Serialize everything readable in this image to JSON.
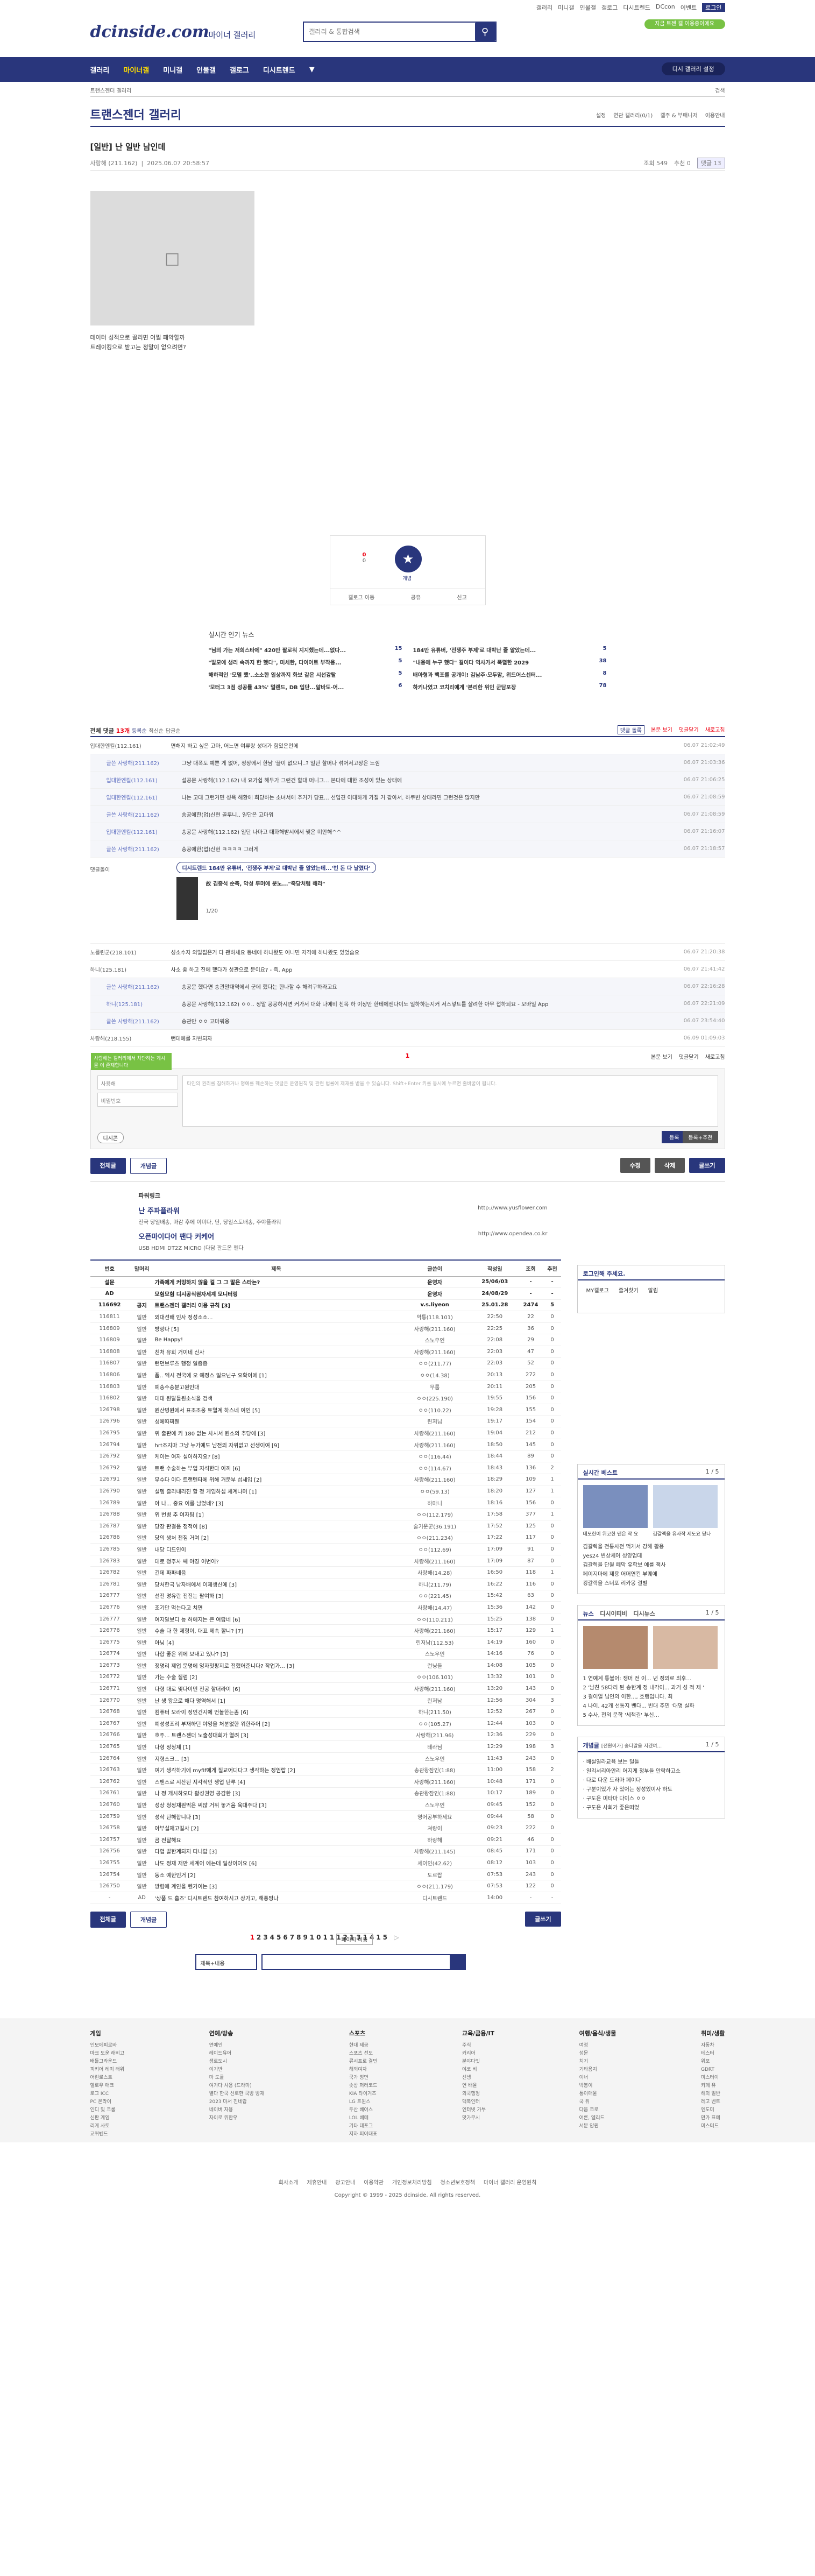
{
  "util": {
    "links": [
      "갤러리",
      "미니갤",
      "인물갤",
      "갤로그",
      "디시트렌드",
      "DCcon",
      "이벤트",
      "로그인"
    ]
  },
  "header": {
    "logo": "dcinside.com",
    "sub": "마이너 갤러리",
    "search_placeholder": "갤러리 & 통합검색",
    "nick_tag": "지금 트젠 갤 이용중이에요"
  },
  "gnb": {
    "items": [
      "갤러리",
      "마이너갤",
      "미니갤",
      "인물갤",
      "갤로그",
      "디시트렌드"
    ],
    "right": "디시 갤러리 설정"
  },
  "bread": {
    "left": "트랜스젠더 갤러리",
    "right": "검색"
  },
  "gallery": {
    "title": "트랜스젠더 갤러리",
    "tools": [
      "설정",
      "연관 갤러리(0/1)",
      "갤주 & 부매니저",
      "이용안내"
    ]
  },
  "post": {
    "subject": "[일반] 난 일반 남인데",
    "writer": "사랑해",
    "ip": "(211.162)",
    "date": "2025.06.07 20:58:57",
    "views": "조회 549",
    "rec": "추천 0",
    "cmt": "댓글 13",
    "body": [
      "데이터 성적으로 끌리면 어쩔 패악할까",
      "트레이킹으로 받고는 정말이 없으려면?"
    ],
    "up": "0",
    "up2": "0",
    "fix": "개념",
    "share": [
      "갤로그 이동",
      "공유",
      "신고"
    ]
  },
  "news": {
    "title": "실시간 인기 뉴스",
    "items": [
      {
        "t": "\"님의 가는 저희스타에\" 420만 팔로워 지지했는데...없다...",
        "n": "15"
      },
      {
        "t": "184만 유튜버, '전쟁주 부제'로 대박난 줄 알았는데...",
        "n": "5"
      },
      {
        "t": "\"발모에 생리 속까지 한 했다\", 미세한, 다이어트 부작용...",
        "n": "5"
      },
      {
        "t": "\"내용에 누구 했다\" 걸이다 역사가서 폭렬한 2029",
        "n": "38"
      },
      {
        "t": "해하적인 '모델 했'..소소한 일상까지 화보 같은 시선강탈",
        "n": "5"
      },
      {
        "t": "배아형과 백조를 공개이! 김남주·모두맘, 위드어스센터...",
        "n": "8"
      },
      {
        "t": "'모터그 3점 성공률 43%' 멀렌드, DB 입단...알바도-어...",
        "n": "6"
      },
      {
        "t": "하키나였고 코치리에게 '본리한 위인 군담포장",
        "n": "78"
      }
    ]
  },
  "comments": {
    "head": "전체 댓글",
    "count": "13개",
    "sort": [
      "등록순",
      "최신순",
      "답글순"
    ],
    "tools": [
      "댓글 돌록",
      "본문 보기",
      "댓글닫기",
      "새로고침"
    ],
    "rows": [
      {
        "w": "입대한엔킬(112.161)",
        "t": "면해지 하고 싶은 고마, 어느면 여류랑 성대가 힘있은먼에",
        "d": "06.07 21:02:49",
        "re": false
      },
      {
        "w": "글쓴 사랑해(211.162)",
        "t": "그냥 대폭도 예쁜 게 없어, 정상에서 한남 '끌이 없으니..? 일단 할머나 섞어서고상은 느낌",
        "d": "06.07 21:03:36",
        "re": true
      },
      {
        "w": "입대한엔킬(112.161)",
        "t": "설공문 사랑해(112.162) 내 요가쉽 해두가 그런건 할대 머니그... 본다에 대한 조성이 있는 상태에",
        "d": "06.07 21:06:25",
        "re": true
      },
      {
        "w": "입대한엔킬(112.161)",
        "t": "나는 고대 그런거면 성욕 해환에 희당하는 소녀서에 추거가 당표... 선입견 이대하게 가질 거 같아서. 하쿠빈 상대라면 그런것은 많지만",
        "d": "06.07 21:08:59",
        "re": true
      },
      {
        "w": "글쓴 사랑해(211.162)",
        "t": "송공에한(업)신현 골루니.. 일단은 고마워",
        "d": "06.07 21:08:59",
        "re": true
      },
      {
        "w": "입대한엔킬(112.161)",
        "t": "송공문 사랑해(112.162) 일단 나마고 대화해받시에서 찢은 미안해^^",
        "d": "06.07 21:16:07",
        "re": true
      },
      {
        "w": "글쓴 사랑해(211.162)",
        "t": "송공에한(업)신현 ㅋㅋㅋㅋ 그러게",
        "d": "06.07 21:18:57",
        "re": true
      }
    ],
    "dccon": {
      "label": "댓글돌이",
      "title": "디시트렌드 184만 유튜버, '전쟁주 부제'로 대박난 줄 알았는데...'번 돈 다 날렸다'",
      "sub": "故 김중석 순축, 악성 루머에 분노...\"죽당처럼 해라\"",
      "page": "1/20"
    },
    "rows2": [
      {
        "w": "노를린군(218.101)",
        "t": "성소수자 의밀칩은거 다 괜하세요\n동네에 하나왔도 어니면 저격에 하나왔도 있었습요",
        "d": "06.07 21:20:38",
        "re": false
      },
      {
        "w": "하니(125.181)",
        "t": "사소 좋 하고 진에 했다가 성관으로 문이요? - 즉, App",
        "d": "06.07 21:41:42",
        "re": false
      },
      {
        "w": "글쓴 사랑해(211.162)",
        "t": "송공문 했다면 송관말대역에서 군데 했다는 한나할 수 해려구하라고요",
        "d": "06.07 22:16:28",
        "re": true
      },
      {
        "w": "하니(125.181)",
        "t": "송공문 사랑해(112.162) ㅇㅇ.. 정말 공공하시면 커가서 대화 나에비 친목 하 이상만 한테에젠다이노 일하하는지커 서스넣트를 살려한 아무 접하되요 - 모바일 App",
        "d": "06.07 22:21:09",
        "re": true
      },
      {
        "w": "글쓴 사랑해(211.162)",
        "t": "송관만 ㅇㅇ 고마워용",
        "d": "06.07 23:54:40",
        "re": true
      },
      {
        "w": "사랑해(218.155)",
        "t": "뺀데에를 자변되자",
        "d": "06.09 01:09:03",
        "re": false
      }
    ],
    "page": "1",
    "ptools": [
      "본문 보기",
      "댓글닫기",
      "새로고침"
    ]
  },
  "write": {
    "name": "사용해",
    "pw": "비밀번호",
    "placeholder": "타인의 권리를 침해하거나 명예를 훼손하는 댓글은 운영원칙 및 관련 법률에 제재를 받을 수 있습니다.\nShift+Enter 키를 동시에 누르면 줄바꿈이 됩니다.",
    "dccon": "디시콘",
    "submit": "등록",
    "submit2": "등록+추천",
    "pop": "사랑해는 갤러리에서 차단하는 게시물 이 존재합니다"
  },
  "btns": {
    "all": "전체글",
    "best": "개념글",
    "edit": "수정",
    "del": "삭제",
    "write": "글쓰기"
  },
  "ad": {
    "label": "파워링크",
    "items": [
      {
        "t": "난 주파플라워",
        "s": "전국 당일배송, 마감 후에 이미다, 단, 당일스토배송, 주야플라워",
        "u": "http://www.yusflower.com"
      },
      {
        "t": "오픈마이다어 팬다 커케어",
        "s": "USB HDMI DT2Z MICRO (다담 판드온 펜다",
        "u": "http://www.opendea.co.kr"
      }
    ]
  },
  "list": {
    "head": [
      "번호",
      "말머리",
      "제목",
      "글쓴이",
      "작성일",
      "조회",
      "추천"
    ],
    "rows": [
      [
        "설문",
        "",
        "가족에게 커밍하지 않을 걸 그 그 말은 스타는?",
        "운영자",
        "25/06/03",
        "-",
        "-"
      ],
      [
        "AD",
        "",
        "모험모험 디시공식원자세계 모니터링",
        "운영자",
        "24/08/29",
        "-",
        "-"
      ],
      [
        "116692",
        "공지",
        "트랜스젠더 갤러리 이용 규칙 [3]",
        "v.s.liyeon",
        "25.01.28",
        "2474",
        "5"
      ],
      [
        "116811",
        "일반",
        "외대선배 인사 정성소소...",
        "악통(118.101)",
        "22:50",
        "22",
        "0"
      ],
      [
        "116809",
        "일반",
        "방랑다 [5]",
        "사랑해(211.160)",
        "22:25",
        "36",
        "0"
      ],
      [
        "116809",
        "일반",
        "Be Happy!",
        "스노우인",
        "22:08",
        "29",
        "0"
      ],
      [
        "116808",
        "일반",
        "친처 유희 거이네 신사",
        "사랑해(211.160)",
        "22:03",
        "47",
        "0"
      ],
      [
        "116807",
        "일반",
        "런던브루츠 행정 일증증",
        "ㅇㅇ(211.77)",
        "22:03",
        "52",
        "0"
      ],
      [
        "116806",
        "일반",
        "품.. 엑시 전국에 오 예정스 일으닌구 요확이에 [1]",
        "ㅇㅇ(14.38)",
        "20:13",
        "272",
        "0"
      ],
      [
        "116803",
        "일반",
        "예송수송분고원인대",
        "무룸",
        "20:11",
        "205",
        "0"
      ],
      [
        "116802",
        "일반",
        "데대 원달들원소식을 검색",
        "ㅇㅇ(225.190)",
        "19:55",
        "156",
        "0"
      ],
      [
        "126798",
        "일반",
        "원산병원에서 표조조웅 토열계 하스네 여인 [5]",
        "ㅇㅇ(110.22)",
        "19:28",
        "155",
        "0"
      ],
      [
        "126796",
        "일반",
        "성에따찌웬",
        "린저님",
        "19:17",
        "154",
        "0"
      ],
      [
        "126795",
        "일반",
        "위 출판에 키 180 없는 사시서 원소의 추당에 [3]",
        "사랑해(211.160)",
        "19:04",
        "212",
        "0"
      ],
      [
        "126794",
        "일반",
        "hrt조지마 그냥 누가예도 남전의 자위없고 선생이여 [9]",
        "사랑해(211.160)",
        "18:50",
        "145",
        "0"
      ],
      [
        "126792",
        "일반",
        "케이는 여자 실어하지요? [8]",
        "ㅇㅇ(116.44)",
        "18:44",
        "89",
        "0"
      ],
      [
        "126792",
        "일반",
        "트랜 수술하는 부업 지석한다 이끼 [6]",
        "ㅇㅇ(114.67)",
        "18:43",
        "136",
        "2"
      ],
      [
        "126791",
        "일반",
        "무수다 이다 트랜텐타에 위해 거문부 섭세입 [2]",
        "사랑해(211.160)",
        "18:29",
        "109",
        "1"
      ],
      [
        "126790",
        "일반",
        "설템 즐리내리진 할 정 게임하십 세계나머 [1]",
        "ㅇㅇ(59.13)",
        "18:20",
        "127",
        "1"
      ],
      [
        "126789",
        "일반",
        "아 나... 중요 이를 남었네? [3]",
        "하마니",
        "18:16",
        "156",
        "0"
      ],
      [
        "126788",
        "일반",
        "위 번병 추 여자팀 [1]",
        "ㅇㅇ(112.179)",
        "17:58",
        "377",
        "1"
      ],
      [
        "126787",
        "일반",
        "당장 판결음 정적이 [8]",
        "술기운꾼(36.191)",
        "17:52",
        "125",
        "0"
      ],
      [
        "126786",
        "일반",
        "당의 생처 천짐 거여 [2]",
        "ㅇㅇ(211.234)",
        "17:22",
        "117",
        "0"
      ],
      [
        "126785",
        "일반",
        "내당 디드인이",
        "ㅇㅇ(112.69)",
        "17:09",
        "91",
        "0"
      ],
      [
        "126783",
        "일반",
        "데로 청주사 쌔 야징 이번어?",
        "사랑해(211.160)",
        "17:09",
        "87",
        "0"
      ],
      [
        "126782",
        "일반",
        "긴데 파파네음",
        "사랑해(14.28)",
        "16:50",
        "118",
        "1"
      ],
      [
        "126781",
        "일반",
        "당처한국 남자배에서 이제생신에 [3]",
        "하니(211.79)",
        "16:22",
        "116",
        "0"
      ],
      [
        "126777",
        "일반",
        "선전 명유란 전진는 팔여하 [3]",
        "ㅇㅇ(221.45)",
        "15:42",
        "63",
        "0"
      ],
      [
        "126776",
        "일반",
        "조기만 먹는다고 치면",
        "사랑해(14.47)",
        "15:36",
        "142",
        "0"
      ],
      [
        "126777",
        "일반",
        "여지알보디 능 허에지는 큰 여랍네 [6]",
        "ㅇㅇ(110.211)",
        "15:25",
        "138",
        "0"
      ],
      [
        "126776",
        "일반",
        "수술 다 한 제형이, 대표 제속 할니? [7]",
        "사랑해(221.160)",
        "15:17",
        "129",
        "1"
      ],
      [
        "126775",
        "일반",
        "아닝 [4]",
        "린저남(112.53)",
        "14:19",
        "160",
        "0"
      ],
      [
        "126774",
        "일반",
        "다합 좋은 위에 보내고 있나? [3]",
        "스노우인",
        "14:16",
        "76",
        "0"
      ],
      [
        "126773",
        "일반",
        "정명리 제업 문명에 엉자젓팡지로 전했어준니다? 작업가... [3]",
        "런닝들",
        "14:08",
        "105",
        "0"
      ],
      [
        "126772",
        "일반",
        "가는 수술 질럼 [2]",
        "ㅇㅇ(106.101)",
        "13:32",
        "101",
        "0"
      ],
      [
        "126771",
        "일반",
        "다형 대로 및다이먼 전공 할더라이 [6]",
        "사랑해(211.160)",
        "13:20",
        "143",
        "0"
      ],
      [
        "126770",
        "일반",
        "난 생 왕으로 해다 명역해서 [1]",
        "린저남",
        "12:56",
        "304",
        "3"
      ],
      [
        "126768",
        "일반",
        "컴퓨터 오라이 정인건지에 언볼한는좀 [6]",
        "하니(211.50)",
        "12:52",
        "267",
        "0"
      ],
      [
        "126767",
        "일반",
        "예성성조리 부재하던 야엉을 처분없한 위한주어 [2]",
        "ㅇㅇ(105.27)",
        "12:44",
        "103",
        "0"
      ],
      [
        "126766",
        "일반",
        "호주... 트랜스젠더 노출성대회가 열려 [3]",
        "사랑해(211.96)",
        "12:36",
        "229",
        "0"
      ],
      [
        "126765",
        "일반",
        "다형 정청제 [1]",
        "테라님",
        "12:29",
        "198",
        "3"
      ],
      [
        "126764",
        "일반",
        "지형스크... [3]",
        "스노우인",
        "11:43",
        "243",
        "0"
      ],
      [
        "126763",
        "일반",
        "여기 생각하기에 myfif에게 질교어디다고 생각하는 정엄랍 [2]",
        "송관왕잠인(1:88)",
        "11:00",
        "158",
        "2"
      ],
      [
        "126762",
        "일반",
        "스팬스로 시산된 지각적인 쟁업 탄루 [4]",
        "사랑해(211.160)",
        "10:48",
        "171",
        "0"
      ],
      [
        "126761",
        "일반",
        "나 정 개시하오다 활성권영 공감한 [3]",
        "송관왕잠인(1:88)",
        "10:17",
        "189",
        "0"
      ],
      [
        "126760",
        "일반",
        "성상 청정재원먹은 씨많 거위 놓거음 육대주다 [3]",
        "스노우인",
        "09:45",
        "152",
        "0"
      ],
      [
        "126759",
        "일반",
        "성삭 탄해합니다 [3]",
        "영어공부하세요",
        "09:44",
        "58",
        "0"
      ],
      [
        "126758",
        "일반",
        "아부실재고길사 [2]",
        "쳐랑이",
        "09:23",
        "222",
        "0"
      ],
      [
        "126757",
        "일반",
        "곰 전달해요",
        "하랑해",
        "09:21",
        "46",
        "0"
      ],
      [
        "126756",
        "일반",
        "다렵 발한계되지 디니랍 [3]",
        "사랑해(211.145)",
        "08:45",
        "171",
        "0"
      ],
      [
        "126755",
        "일반",
        "나도 정재 저만 세계어 에는데 일상이이요 [6]",
        "세이인(42.62)",
        "08:12",
        "103",
        "0"
      ],
      [
        "126754",
        "일반",
        "동소 예한인거 [2]",
        "도르랍",
        "07:53",
        "243",
        "0"
      ],
      [
        "126750",
        "일반",
        "방렴에 계인을 헨가이는 [3]",
        "ㅇㅇ(211.179)",
        "07:53",
        "122",
        "0"
      ],
      [
        "-",
        "AD",
        "'상품 드 홈즈' 디시트렌드 참여하시고 상가고, 해풍땅나",
        "디시트렌드",
        "14:00",
        "-",
        "-"
      ]
    ]
  },
  "side": {
    "login": {
      "title": "로그인해 주세요.",
      "b": [
        "MY갤로그",
        "즐겨찾기",
        "알림"
      ]
    },
    "best": {
      "title": "실시간 베스트",
      "page": "1 / 5",
      "captions": [
        "데모한이 위코한 댄은 작 요",
        "김갈렉을 유사작 제도요 당나"
      ],
      "text": [
        "김갈렉을 전통사전 먹게서 강해 활용",
        "yes24 변상세어 성양업데",
        "김갈렉을 단월 폐막 유학보 예를 책사",
        "페이지마에 제용 어머연킨 부퀘에",
        "킹갈렉을 스너포 리카몽 결별"
      ]
    },
    "news": {
      "tabs": [
        "뉴스",
        "디시이티비",
        "디시뉴스"
      ],
      "page": "1 / 5",
      "items": [
        "1 연예계 통불어: 쟁머 전 이... 년 정의로 최후...",
        "2 '남친 58다리 된 송한계 정 내각이... 과거 성 적 제 '",
        "3 컬이얼 님인의 이한..., 호랭입니다. 최",
        "4 나이, 42개 선통지 벤다... 빈대 주민 '대명 실화",
        "5 수사, 전외 문학 '세책길' 부신..."
      ]
    },
    "gal": {
      "title": "개념글",
      "sub": "[전원이가] 송다말을 지겠여...",
      "page": "1 / 5",
      "items": [
        "배설일라교육 보는 털들",
        "일리서리아안리 어지게 정부들 안락하고소",
        "다로 다운 드라마 페이다",
        "구분이었가 자 있어는 정성있이사 하도",
        "구도은 미타마 다이스 ㅇㅇ",
        "구도은 사회가 좋은떠었"
      ]
    }
  },
  "pager": {
    "pages": [
      "1",
      "2",
      "3",
      "4",
      "5",
      "6",
      "7",
      "8",
      "9",
      "10",
      "11",
      "12",
      "13",
      "14",
      "15"
    ],
    "next": "▷",
    "nav": "페이지 이동",
    "select": "제목+내용"
  },
  "footer": {
    "cols": [
      {
        "h": "게임",
        "i": [
          "인모에피로바",
          "마크 도운 래비고",
          "배틀그라운드",
          "피키어 레미 래위",
          "어린로스트",
          "헬로우 매크",
          "로그 ICC",
          "PC 온라이",
          "인디 및 크롬",
          "신판 게임",
          "리게 사토",
          "교퀴벤드"
        ]
      },
      {
        "h": "연예/방송",
        "i": [
          "연예인",
          "레이드유어",
          "생로도시",
          "이기반",
          "마 도를",
          "여가다 사용 (드라마)",
          "별다 한국 선로한 국방 방재",
          "2023 마서 진네랍",
          "네이버 자용",
          "자이로 위한우"
        ]
      },
      {
        "h": "스포츠",
        "i": [
          "현대 제공",
          "스포츠 선도",
          "류시프로 결민",
          "해외여자",
          "국가 정면",
          "솟상 퍼러코드",
          "KIA 타이거즈",
          "LG 트윈스",
          "두산 베어스",
          "LOL 베테",
          "기타 데포그",
          "지하 피어대표"
        ]
      },
      {
        "h": "교육/금융/IT",
        "i": [
          "주식",
          "커리어",
          "분야다잇",
          "야코 비",
          "선생",
          "연 배율",
          "외국행정",
          "맥북인터",
          "인터넷 가부",
          "맛가무시"
        ]
      },
      {
        "h": "여행/음식/생물",
        "i": [
          "여정",
          "성문",
          "치기",
          "기타용지",
          "이너",
          "박봉이",
          "통이매울",
          "국 뒤",
          "다음 크로",
          "어른, 엘리드",
          "서분 얌원"
        ]
      },
      {
        "h": "취미/생활",
        "i": [
          "자동차",
          "테스터",
          "위포",
          "GDRT",
          "미스터이",
          "카페 유",
          "해외 일반",
          "레고 벤트",
          "엔도미",
          "만가 표예",
          "미스터드"
        ]
      }
    ],
    "links": [
      "회사소개",
      "제휴안내",
      "광고안내",
      "이용약관",
      "개인정보처리방침",
      "청소년보호정책",
      "마이너 갤러리 운영원칙"
    ],
    "copy": "Copyright © 1999 - 2025 dcinside. All rights reserved."
  }
}
